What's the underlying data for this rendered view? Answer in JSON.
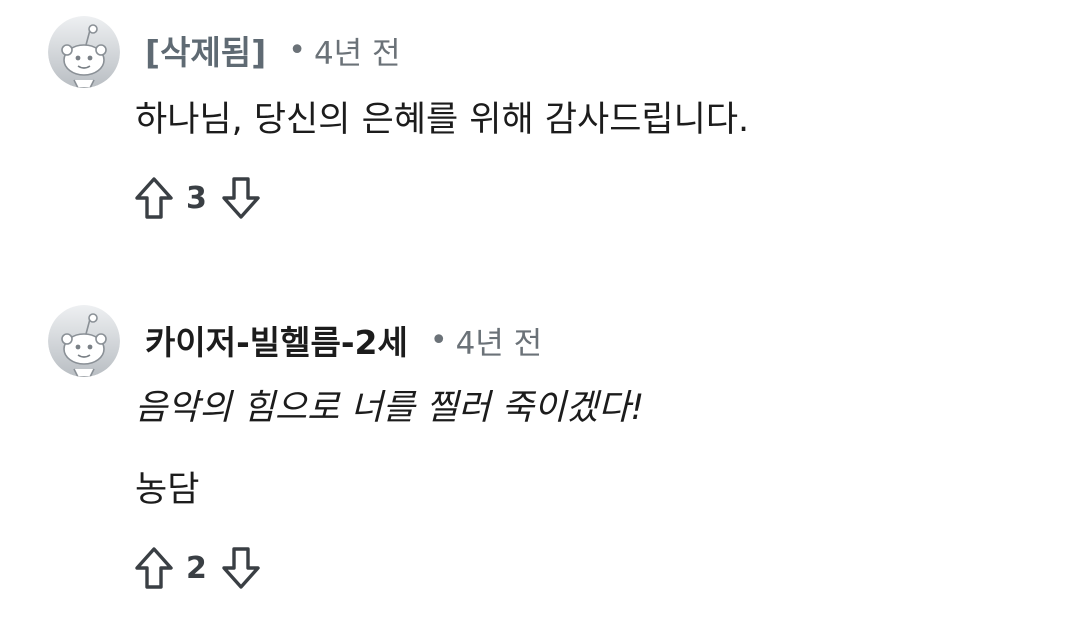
{
  "comments": [
    {
      "username": "[삭제됨]",
      "separator": "•",
      "time": "4년 전",
      "lines": [
        "하나님, 당신의 은혜를 위해 감사드립니다."
      ],
      "votes": "3",
      "avatar_icon": "snoo-avatar-icon"
    },
    {
      "username": "카이저-빌헬름-2세",
      "separator": "•",
      "time": "4년 전",
      "lines": [
        "음악의 힘으로 너를 찔러 죽이겠다!",
        "농담"
      ],
      "votes": "2",
      "avatar_icon": "snoo-avatar-icon"
    }
  ],
  "icons": {
    "upvote": "upvote-arrow-icon",
    "downvote": "downvote-arrow-icon"
  },
  "colors": {
    "deleted_username": "#5f6a73",
    "text": "#1c1c1c",
    "meta": "#6b7278"
  }
}
